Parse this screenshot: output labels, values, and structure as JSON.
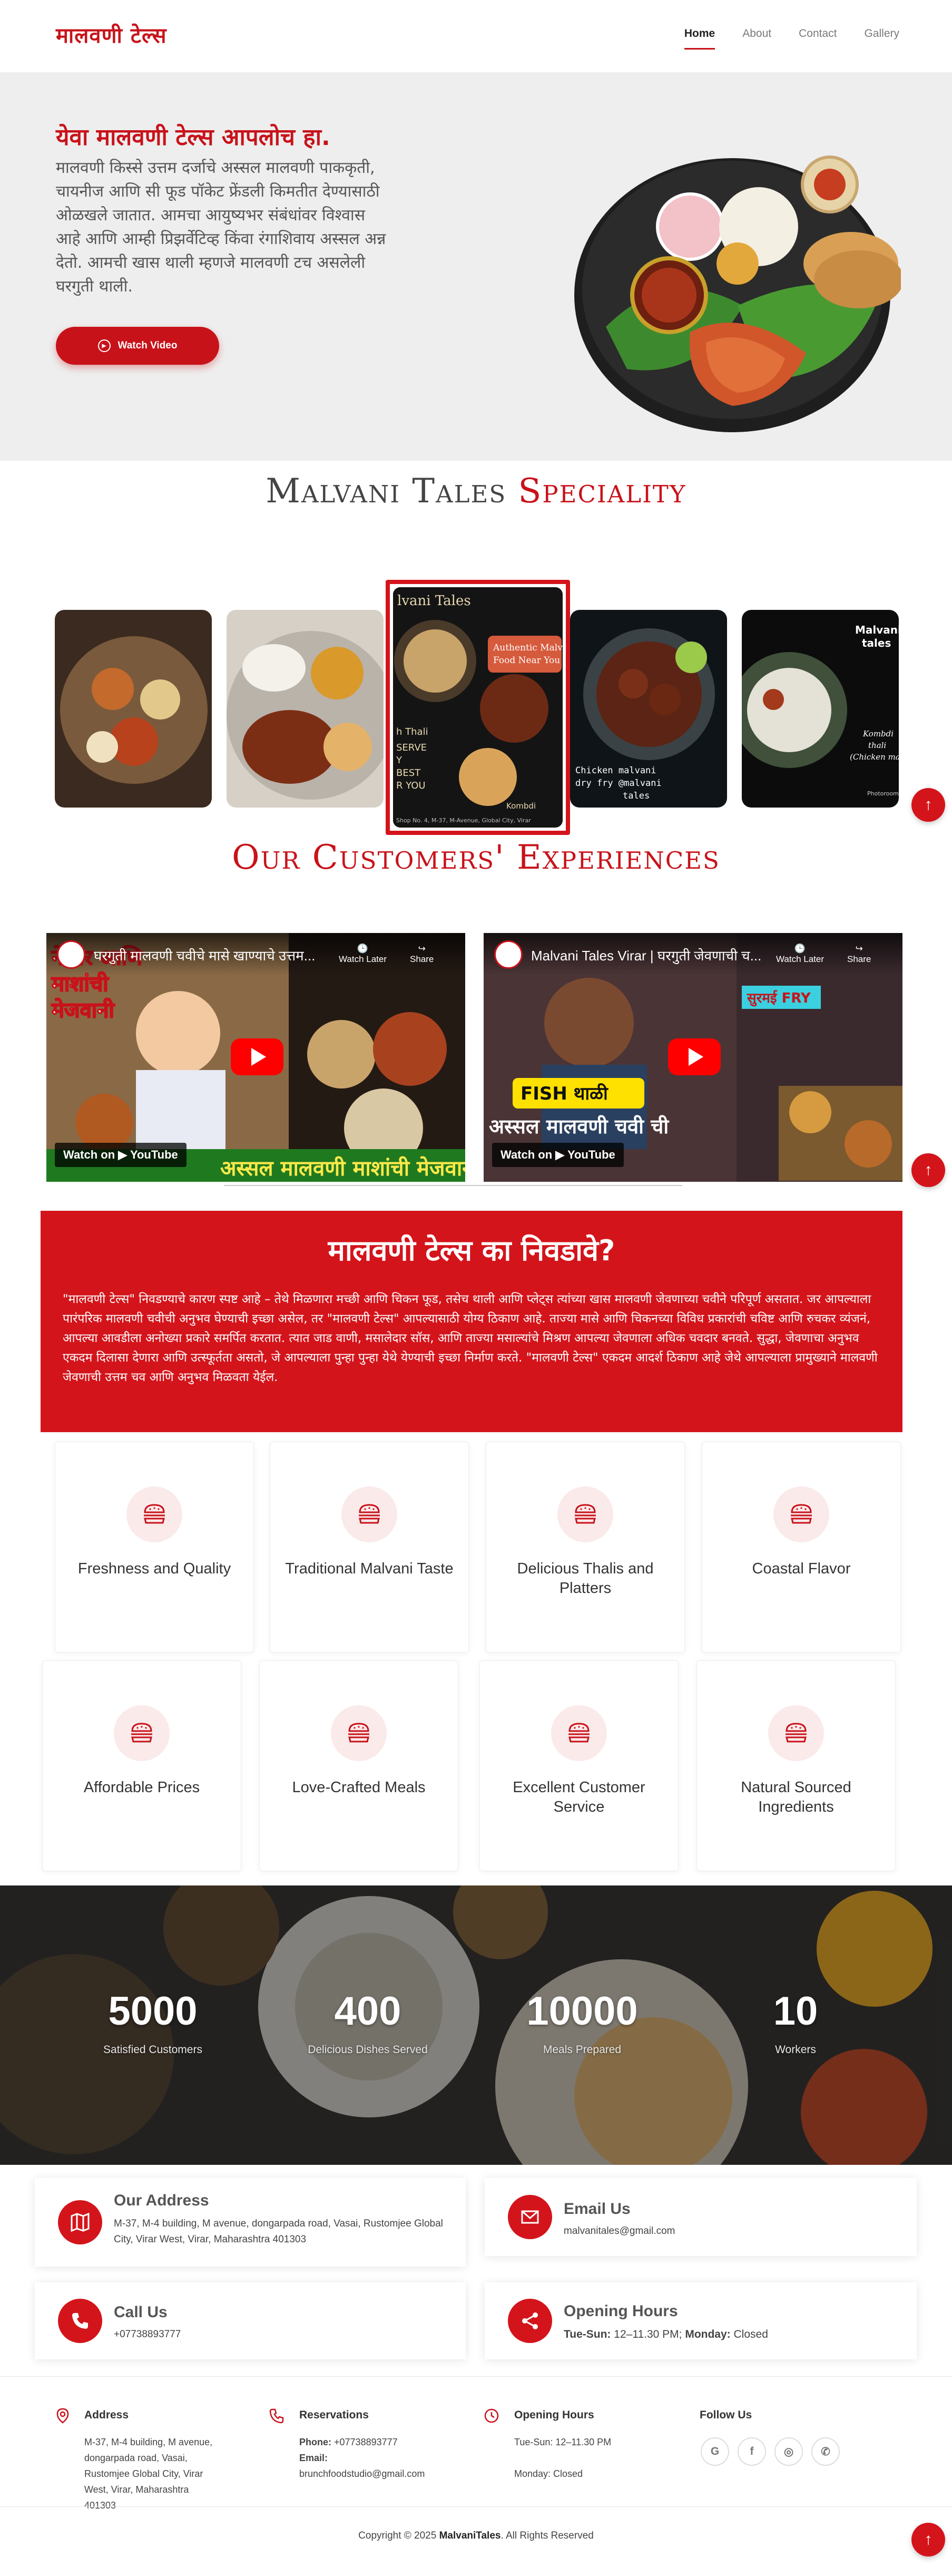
{
  "header": {
    "logo": "मालवणी टेल्स",
    "nav": [
      {
        "label": "Home",
        "active": true
      },
      {
        "label": "About",
        "active": false
      },
      {
        "label": "Contact",
        "active": false
      },
      {
        "label": "Gallery",
        "active": false
      }
    ]
  },
  "hero": {
    "title": "येवा मालवणी टेल्स आपलोच हा",
    "title_dot": ".",
    "text": "मालवणी किस्से उत्तम दर्जाचे अस्सल मालवणी पाककृती, चायनीज आणि सी फूड पॉकेट फ्रेंडली किमतीत देण्यासाठी ओळखले जातात. आमचा आयुष्यभर संबंधांवर विश्वास आहे आणि आम्ही प्रिझर्वेटिव्ह किंवा रंगाशिवाय अस्सल अन्न देतो. आमची खास थाली म्हणजे मालवणी टच असलेली घरगुती थाली.",
    "watch_label": "Watch Video"
  },
  "speciality": {
    "title_part1": "Malvani Tales",
    "title_part2": "Speciality",
    "featured": {
      "brand": "lvani Tales",
      "tagline": "Authentic Malv Food Near You",
      "thali": "h Thali",
      "serve": "SERVE",
      "line2": "Y",
      "line3": "BEST",
      "line4": "R YOU",
      "kombdi": "Kombdi",
      "address": "Shop No. 4, M-37, M-Avenue, Global City, Virar"
    },
    "card4_text": "Chicken malvani dry fry @malvani tales",
    "card5_brand": "Malvani tales",
    "card5_side": "Kombdi thali (Chicken ma",
    "card5_credit": "Photoroom"
  },
  "customers": {
    "title": "Our Customers' Experiences",
    "videos": [
      {
        "title": "घरगुती मालवणी चवीचे मासे खाण्याचे उत्तम...",
        "overlay_top": "नेश्वर आणि माशांची मेजवानी",
        "banner": "अस्सल मालवणी माशांची मेजवानी",
        "watch_later": "Watch Later",
        "share": "Share",
        "watch_on": "Watch on",
        "yt": "YouTube"
      },
      {
        "title": "Malvani Tales Virar | घरगुती जेवणाची च...",
        "fry": "सुरमई FRY",
        "fish": "FISH थाळी",
        "banner": "अस्सल मालवणी चवी ची",
        "watch_later": "Watch Later",
        "share": "Share",
        "watch_on": "Watch on",
        "yt": "YouTube"
      }
    ]
  },
  "why": {
    "title": "मालवणी टेल्स का निवडावे?",
    "text": "\"मालवणी टेल्स\" निवडण्याचे कारण स्पष्ट आहे – तेथे मिळणारा मच्छी आणि चिकन फूड, तसेच थाली आणि प्लेट्स त्यांच्या खास मालवणी जेवणाच्या चवीने परिपूर्ण असतात. जर आपल्याला पारंपरिक मालवणी चवीची अनुभव घेण्याची इच्छा असेल, तर \"मालवणी टेल्स\" आपल्यासाठी योग्य ठिकाण आहे. ताज्या मासे आणि चिकनच्या विविध प्रकारांची चविष्ट आणि रुचकर व्यंजनं, आपल्या आवडीला अनोख्या प्रकारे समर्पित करतात. त्यात जाड वाणी, मसालेदार सॉस, आणि ताज्या मसाल्यांचे मिश्रण आपल्या जेवणाला अधिक चवदार बनवते. सुद्धा, जेवणाचा अनुभव एकदम दिलासा देणारा आणि उत्स्फूर्तता असतो, जे आपल्याला पुन्हा पुन्हा येथे येण्याची इच्छा निर्माण करते. \"मालवणी टेल्स\" एकदम आदर्श ठिकाण आहे जेथे आपल्याला प्रामुख्याने मालवणी जेवणाची उत्तम चव आणि अनुभव मिळवता येईल."
  },
  "features": [
    "Freshness and Quality",
    "Traditional Malvani Taste",
    "Delicious Thalis and Platters",
    "Coastal Flavor",
    "Affordable Prices",
    "Love-Crafted Meals",
    "Excellent Customer Service",
    "Natural Sourced Ingredients"
  ],
  "stats": [
    {
      "num": "5000",
      "label": "Satisfied Customers"
    },
    {
      "num": "400",
      "label": "Delicious Dishes Served"
    },
    {
      "num": "10000",
      "label": "Meals Prepared"
    },
    {
      "num": "10",
      "label": "Workers"
    }
  ],
  "contact": {
    "address_title": "Our Address",
    "address_text": "M-37, M-4 building, M avenue, dongarpada road, Vasai, Rustomjee Global City, Virar West, Virar, Maharashtra 401303",
    "email_title": "Email Us",
    "email_text": "malvanitales@gmail.com",
    "call_title": "Call Us",
    "call_text": "+07738893777",
    "hours_title": "Opening Hours",
    "hours_days1": "Tue-Sun:",
    "hours_time1": "12–11.30 PM;",
    "hours_days2": "Monday:",
    "hours_time2": "Closed"
  },
  "footer": {
    "address_title": "Address",
    "address_text": "M-37, M-4 building, M avenue, dongarpada road, Vasai, Rustomjee Global City, Virar West, Virar, Maharashtra 401303",
    "res_title": "Reservations",
    "phone_label": "Phone:",
    "phone": "+07738893777",
    "email_label": "Email:",
    "email": "brunchfoodstudio@gmail.com",
    "hours_title": "Opening Hours",
    "hours1": "Tue-Sun: 12–11.30 PM",
    "hours2": "Monday: Closed",
    "follow_title": "Follow Us",
    "social": [
      {
        "icon": "google-icon",
        "glyph": "G"
      },
      {
        "icon": "facebook-icon",
        "glyph": "f"
      },
      {
        "icon": "instagram-icon",
        "glyph": "◎"
      },
      {
        "icon": "whatsapp-icon",
        "glyph": "✆"
      }
    ],
    "copyright_pre": "Copyright © 2025",
    "brand": "MalvaniTales",
    "copyright_post": ". All Rights Reserved"
  },
  "colors": {
    "accent": "#c8121a",
    "hero_bg": "#eeeeee"
  }
}
